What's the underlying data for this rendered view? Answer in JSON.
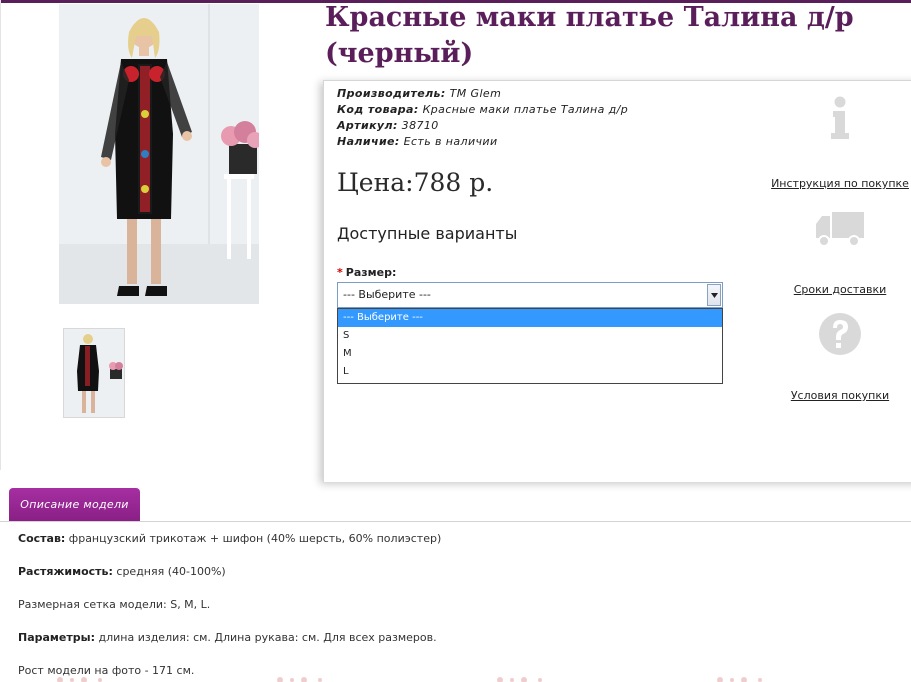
{
  "product": {
    "title": "Красные маки платье Талина д/р (черный)"
  },
  "meta": {
    "manufacturer_label": "Производитель:",
    "manufacturer_value": "ТМ Glem",
    "code_label": "Код товара:",
    "code_value": "Красные маки платье Талина д/р",
    "article_label": "Артикул:",
    "article_value": "38710",
    "stock_label": "Наличие:",
    "stock_value": "Есть в наличии"
  },
  "price": "Цена:788 р.",
  "options": {
    "title": "Доступные варианты",
    "size_label": "Размер:",
    "required_mark": "*",
    "selected": "--- Выберите ---",
    "items": [
      "--- Выберите ---",
      "S",
      "M",
      "L"
    ]
  },
  "side_links": {
    "instructions": "Инструкция по покупке",
    "delivery": "Сроки доставки",
    "terms": "Условия покупки"
  },
  "icons": {
    "info": "info-icon",
    "truck": "truck-icon",
    "question": "question-icon"
  },
  "colors": {
    "brand": "#5a1f5a",
    "tab": "#9b2797",
    "icon_gray": "#d9d9d9",
    "select_highlight": "#3399ff"
  },
  "tabs": {
    "description": "Описание модели"
  },
  "description": {
    "composition_label": "Состав:",
    "composition_value": " французский трикотаж + шифон (40% шерсть, 60% полиэстер)",
    "stretch_label": "Растяжимость:",
    "stretch_value": " средняя (40-100%)",
    "sizes_text": "Размерная сетка модели: S, M, L.",
    "params_label": "Параметры:",
    "params_value": " длина изделия: см. Длина рукава: см. Для всех размеров.",
    "model_height": "Рост модели на фото - 171 см."
  }
}
